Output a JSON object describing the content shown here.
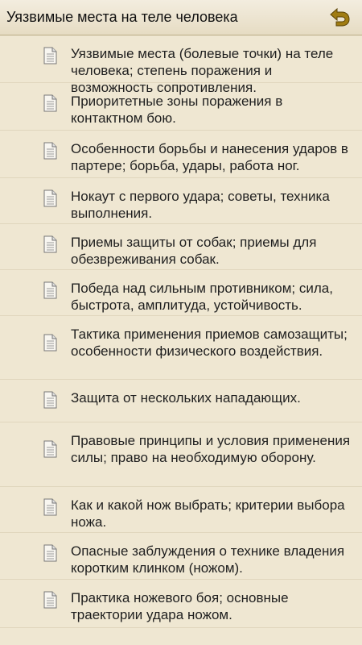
{
  "header": {
    "title": "Уязвимые места на теле человека",
    "back_icon": "back-arrow-icon"
  },
  "items": [
    {
      "label": "Уязвимые места (болевые точки) на теле человека; степень поражения и возможность сопротивления."
    },
    {
      "label": "Приоритетные зоны поражения в контактном бою."
    },
    {
      "label": "Особенности борьбы и нанесения ударов в партере; борьба, удары, работа ног."
    },
    {
      "label": "Нокаут с первого удара; советы, техника выполнения."
    },
    {
      "label": "Приемы защиты от собак; приемы для обезвреживания собак."
    },
    {
      "label": "Победа над сильным противником; сила, быстрота, амплитуда, устойчивость."
    },
    {
      "label": "Тактика применения приемов самозащиты; особенности физического воздействия."
    },
    {
      "label": "Защита от нескольких нападающих."
    },
    {
      "label": "Правовые принципы и условия применения силы; право на необходимую оборону."
    },
    {
      "label": "Как и какой нож выбрать; критерии выбора ножа."
    },
    {
      "label": "Опасные заблуждения о технике владения коротким клинком (ножом)."
    },
    {
      "label": "Практика ножевого боя; основные траектории удара ножом."
    }
  ],
  "colors": {
    "background": "#efe7d2",
    "accent": "#a07c12"
  }
}
